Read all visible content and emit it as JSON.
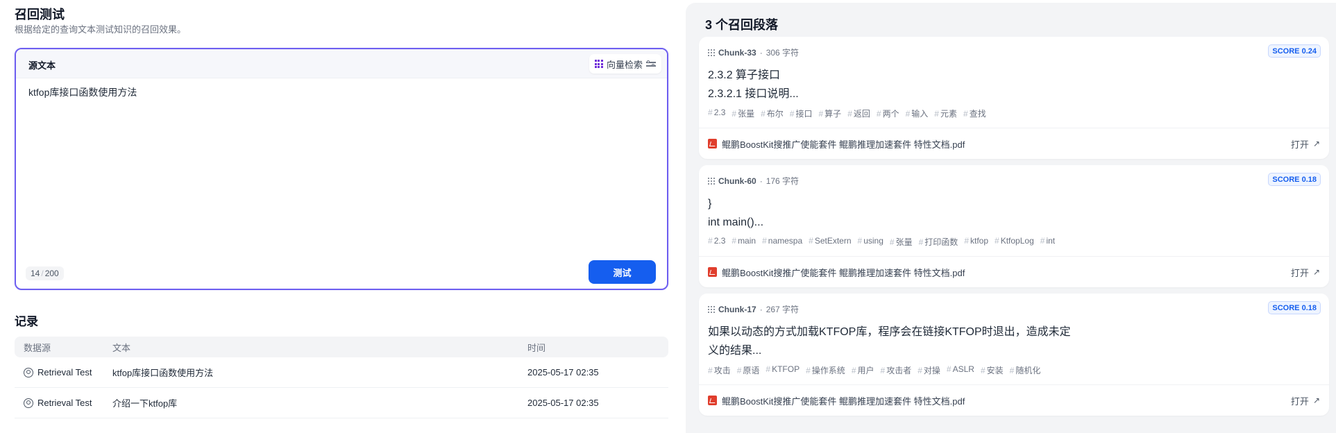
{
  "page": {
    "title": "召回测试",
    "subtitle": "根据给定的查询文本测试知识的召回效果。"
  },
  "query": {
    "label": "源文本",
    "retrieval_mode": "向量检索",
    "text": "ktfop库接口函数使用方法",
    "count": "14",
    "max": "200",
    "submit_label": "测试"
  },
  "records": {
    "title": "记录",
    "headers": [
      "数据源",
      "文本",
      "时间"
    ],
    "rows": [
      {
        "source": "Retrieval Test",
        "text": "ktfop库接口函数使用方法",
        "time": "2025-05-17 02:35"
      },
      {
        "source": "Retrieval Test",
        "text": "介绍一下ktfop库",
        "time": "2025-05-17 02:35"
      }
    ]
  },
  "results": {
    "title": "3 个召回段落",
    "open_label": "打开",
    "chunks": [
      {
        "id": "Chunk-33",
        "chars": "306 字符",
        "score": "SCORE 0.24",
        "lines": [
          "2.3.2 算子接口",
          "2.3.2.1 接口说明..."
        ],
        "tags": [
          "2.3",
          "张量",
          "布尔",
          "接口",
          "算子",
          "返回",
          "两个",
          "输入",
          "元素",
          "查找"
        ],
        "file": "鲲鹏BoostKit搜推广使能套件 鲲鹏推理加速套件 特性文档.pdf"
      },
      {
        "id": "Chunk-60",
        "chars": "176 字符",
        "score": "SCORE 0.18",
        "lines": [
          "}",
          "int main()..."
        ],
        "tags": [
          "2.3",
          "main",
          "namespa",
          "SetExtern",
          "using",
          "张量",
          "打印函数",
          "ktfop",
          "KtfopLog",
          "int"
        ],
        "file": "鲲鹏BoostKit搜推广使能套件 鲲鹏推理加速套件 特性文档.pdf"
      },
      {
        "id": "Chunk-17",
        "chars": "267 字符",
        "score": "SCORE 0.18",
        "lines": [
          "如果以动态的方式加载KTFOP库，程序会在链接KTFOP时退出，造成未定",
          "义的结果..."
        ],
        "tags": [
          "攻击",
          "原语",
          "KTFOP",
          "操作系统",
          "用户",
          "攻击者",
          "对操",
          "ASLR",
          "安装",
          "随机化"
        ],
        "file": "鲲鹏BoostKit搜推广使能套件 鲲鹏推理加速套件 特性文档.pdf"
      }
    ]
  }
}
